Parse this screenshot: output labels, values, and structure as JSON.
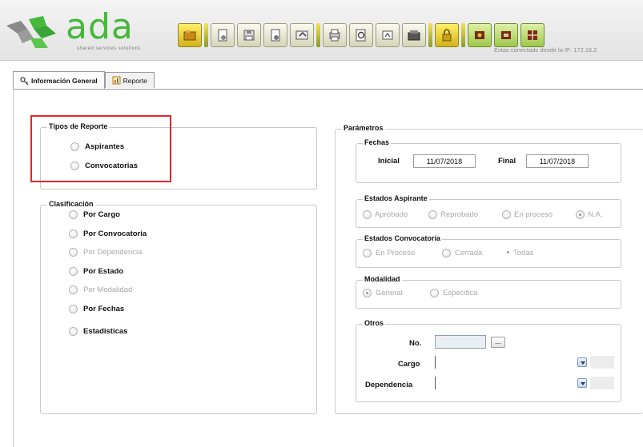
{
  "app": {
    "logo_text": "ada",
    "logo_subtitle": "shared services solutions",
    "status_text": "Estas conectado desde la IP: 172.16.2"
  },
  "toolbar": {
    "buttons": [
      {
        "icon": "open-folder-icon",
        "style": "yellow"
      },
      {
        "icon": "new-document-icon",
        "style": "plain"
      },
      {
        "icon": "save-icon",
        "style": "plain"
      },
      {
        "icon": "document-icon",
        "style": "plain"
      },
      {
        "icon": "undo-icon",
        "style": "plain"
      },
      {
        "icon": "print-icon",
        "style": "plain"
      },
      {
        "icon": "preview-icon",
        "style": "plain"
      },
      {
        "icon": "export-icon",
        "style": "plain"
      },
      {
        "icon": "archive-icon",
        "style": "plain"
      },
      {
        "icon": "lock-icon",
        "style": "yellow"
      },
      {
        "icon": "tool-icon",
        "style": "green"
      },
      {
        "icon": "window-icon",
        "style": "green"
      },
      {
        "icon": "grid-icon",
        "style": "green"
      }
    ]
  },
  "tabs": [
    {
      "label": "Información General",
      "icon": "key-icon",
      "active": true
    },
    {
      "label": "Reporte",
      "icon": "report-icon",
      "active": false
    }
  ],
  "tipos_reporte": {
    "legend": "Tipos de Reporte",
    "options": [
      "Aspirantes",
      "Convocatorias"
    ]
  },
  "clasificacion": {
    "legend": "Clasificación",
    "options": [
      {
        "label": "Por Cargo",
        "enabled": true
      },
      {
        "label": "Por Convocatoria",
        "enabled": true
      },
      {
        "label": "Por Dependencia",
        "enabled": false
      },
      {
        "label": "Por Estado",
        "enabled": true
      },
      {
        "label": "Por Modalidad",
        "enabled": false
      },
      {
        "label": "Por Fechas",
        "enabled": true
      },
      {
        "label": "Estadisticas",
        "enabled": true
      }
    ]
  },
  "parametros": {
    "legend": "Parámetros",
    "fechas": {
      "legend": "Fechas",
      "inicial_label": "Inicial",
      "inicial_value": "11/07/2018",
      "final_label": "Final",
      "final_value": "11/07/2018"
    },
    "estados_aspirante": {
      "legend": "Estados Aspirante",
      "options": [
        "Aprobado",
        "Reprobado",
        "En proceso",
        "N.A."
      ],
      "selected": "N.A."
    },
    "estados_convocatoria": {
      "legend": "Estados Convocatoria",
      "options": [
        "En Proceso",
        "Cerrada",
        "Todas"
      ],
      "selected": "Todas"
    },
    "modalidad": {
      "legend": "Modalidad",
      "options": [
        "General",
        "Especifica"
      ],
      "selected": "General"
    },
    "otros": {
      "legend": "Otros",
      "no_label": "No.",
      "no_value": "",
      "ellipsis_label": "...",
      "cargo_label": "Cargo",
      "cargo_value": "",
      "dependencia_label": "Dependencia",
      "dependencia_value": ""
    }
  },
  "colors": {
    "brand_green": "#46b83c",
    "highlight_red": "#e8242a",
    "disabled_text": "#a8a8a8"
  }
}
